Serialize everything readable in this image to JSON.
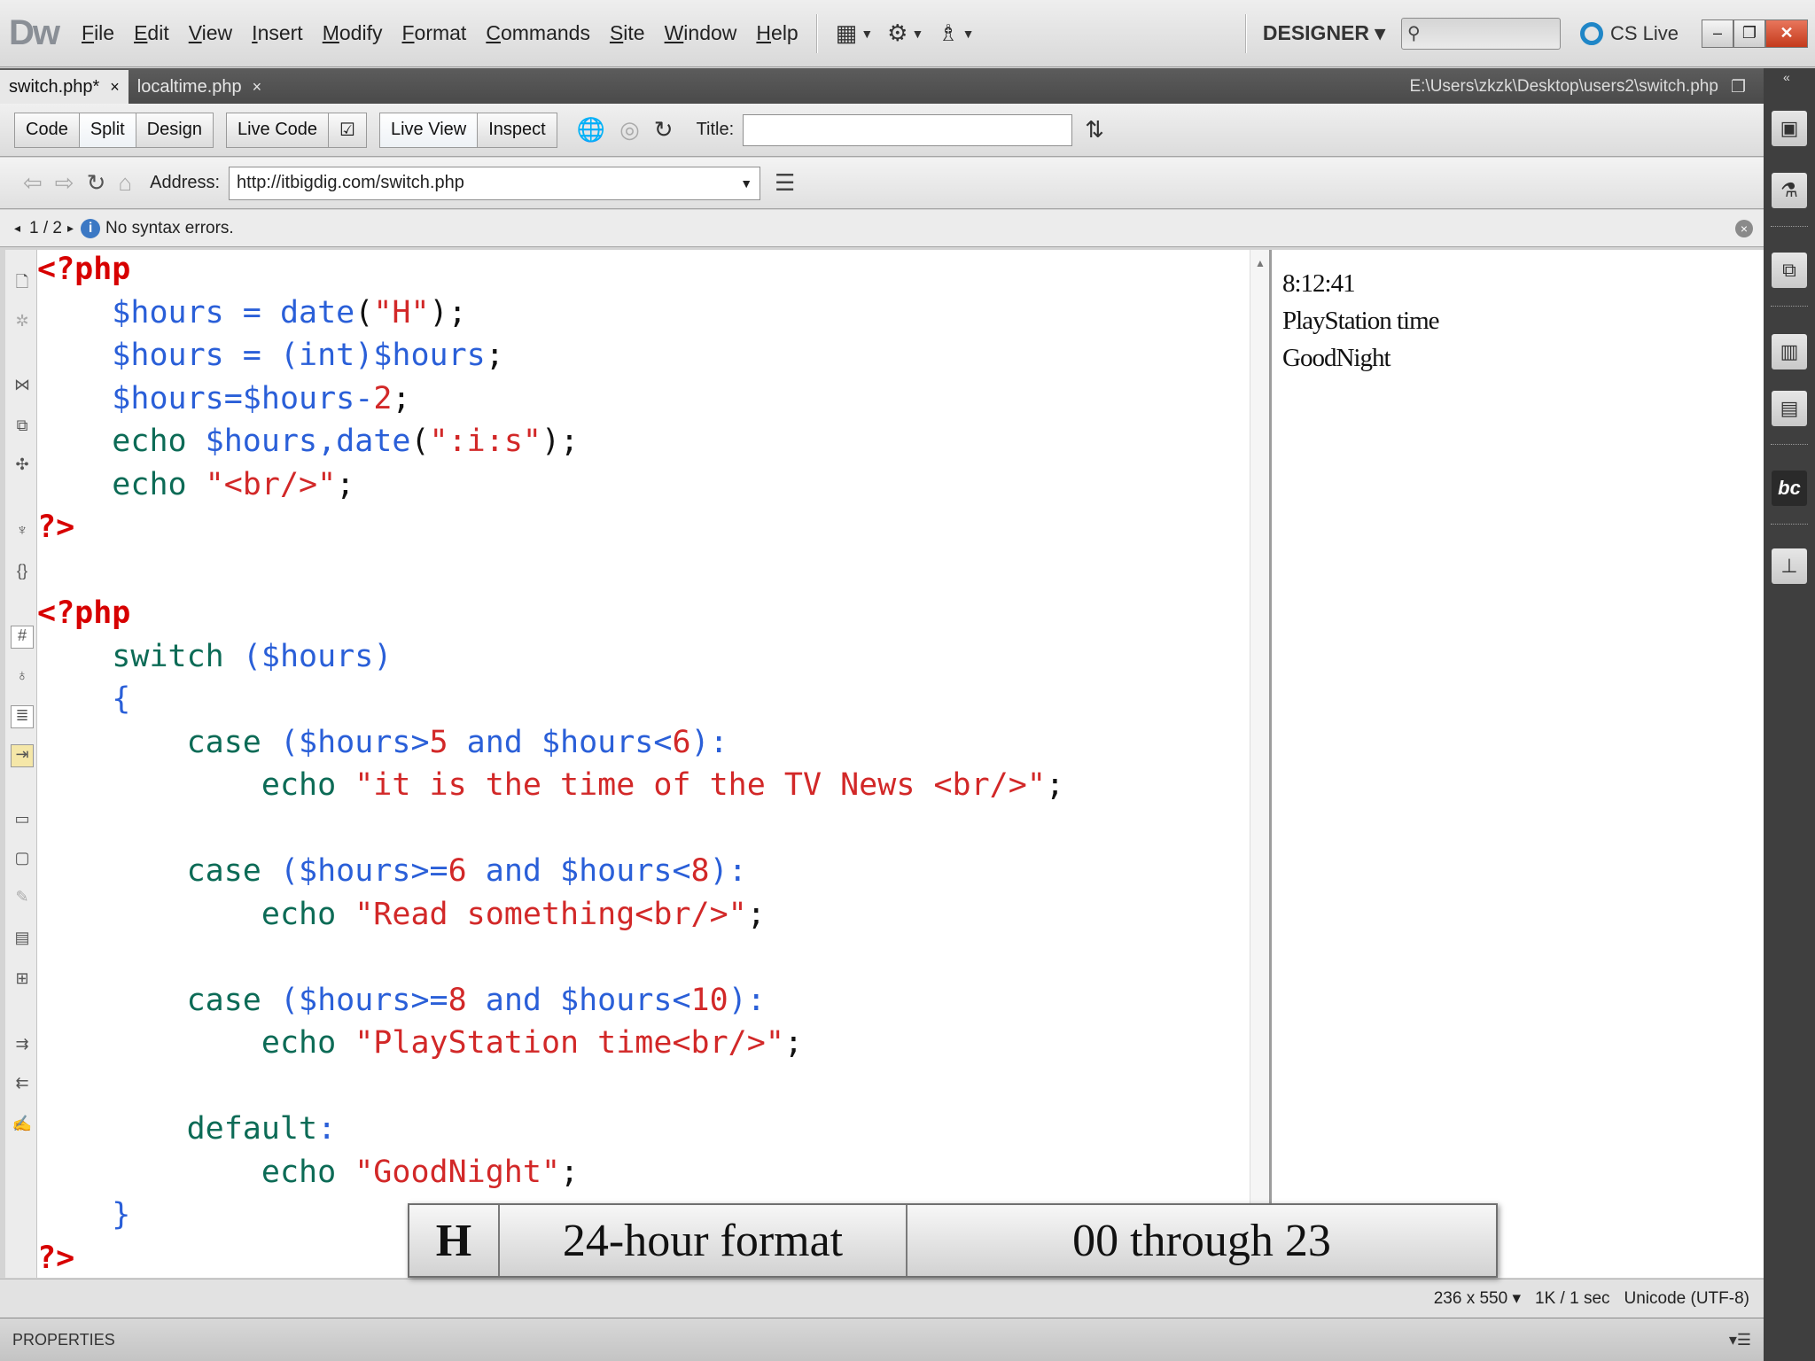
{
  "app": {
    "logo": "Dw",
    "menu": [
      "File",
      "Edit",
      "View",
      "Insert",
      "Modify",
      "Format",
      "Commands",
      "Site",
      "Window",
      "Help"
    ],
    "workspace": "DESIGNER",
    "cslive": "CS Live"
  },
  "tabs": [
    {
      "label": "switch.php*",
      "close": "×"
    },
    {
      "label": "localtime.php",
      "close": "×"
    }
  ],
  "filepath": "E:\\Users\\zkzk\\Desktop\\users2\\switch.php",
  "doc_toolbar": {
    "code": "Code",
    "split": "Split",
    "design": "Design",
    "live_code": "Live Code",
    "live_view": "Live View",
    "inspect": "Inspect",
    "title_label": "Title:",
    "title_value": ""
  },
  "address": {
    "label": "Address:",
    "value": "http://itbigdig.com/switch.php"
  },
  "infobar": {
    "pager": "1 / 2",
    "message": "No syntax errors."
  },
  "code_lines": [
    [
      {
        "c": "tag",
        "t": "<?php"
      }
    ],
    [
      {
        "c": "pn",
        "t": "    "
      },
      {
        "c": "var",
        "t": "$hours"
      },
      {
        "c": "op",
        "t": " = "
      },
      {
        "c": "var",
        "t": "date"
      },
      {
        "c": "pn",
        "t": "("
      },
      {
        "c": "str",
        "t": "\"H\""
      },
      {
        "c": "pn",
        "t": ");"
      }
    ],
    [
      {
        "c": "pn",
        "t": "    "
      },
      {
        "c": "var",
        "t": "$hours"
      },
      {
        "c": "op",
        "t": " = "
      },
      {
        "c": "var",
        "t": "(int)$hours"
      },
      {
        "c": "pn",
        "t": ";"
      }
    ],
    [
      {
        "c": "pn",
        "t": "    "
      },
      {
        "c": "var",
        "t": "$hours=$hours-"
      },
      {
        "c": "num",
        "t": "2"
      },
      {
        "c": "pn",
        "t": ";"
      }
    ],
    [
      {
        "c": "pn",
        "t": "    "
      },
      {
        "c": "kw",
        "t": "echo "
      },
      {
        "c": "var",
        "t": "$hours,date"
      },
      {
        "c": "pn",
        "t": "("
      },
      {
        "c": "str",
        "t": "\":i:s\""
      },
      {
        "c": "pn",
        "t": ");"
      }
    ],
    [
      {
        "c": "pn",
        "t": "    "
      },
      {
        "c": "kw",
        "t": "echo "
      },
      {
        "c": "str",
        "t": "\"<br/>\""
      },
      {
        "c": "pn",
        "t": ";"
      }
    ],
    [
      {
        "c": "tag",
        "t": "?>"
      }
    ],
    [],
    [
      {
        "c": "tag",
        "t": "<?php"
      }
    ],
    [
      {
        "c": "pn",
        "t": "    "
      },
      {
        "c": "kw",
        "t": "switch "
      },
      {
        "c": "var",
        "t": "($hours)"
      }
    ],
    [
      {
        "c": "pn",
        "t": "    "
      },
      {
        "c": "var",
        "t": "{"
      }
    ],
    [
      {
        "c": "pn",
        "t": "        "
      },
      {
        "c": "kw",
        "t": "case "
      },
      {
        "c": "var",
        "t": "($hours>"
      },
      {
        "c": "num",
        "t": "5"
      },
      {
        "c": "var",
        "t": " and $hours<"
      },
      {
        "c": "num",
        "t": "6"
      },
      {
        "c": "var",
        "t": "):"
      }
    ],
    [
      {
        "c": "pn",
        "t": "            "
      },
      {
        "c": "kw",
        "t": "echo "
      },
      {
        "c": "str",
        "t": "\"it is the time of the TV News <br/>\""
      },
      {
        "c": "pn",
        "t": ";"
      }
    ],
    [],
    [
      {
        "c": "pn",
        "t": "        "
      },
      {
        "c": "kw",
        "t": "case "
      },
      {
        "c": "var",
        "t": "($hours>="
      },
      {
        "c": "num",
        "t": "6"
      },
      {
        "c": "var",
        "t": " and $hours<"
      },
      {
        "c": "num",
        "t": "8"
      },
      {
        "c": "var",
        "t": "):"
      }
    ],
    [
      {
        "c": "pn",
        "t": "            "
      },
      {
        "c": "kw",
        "t": "echo "
      },
      {
        "c": "str",
        "t": "\"Read something<br/>\""
      },
      {
        "c": "pn",
        "t": ";"
      }
    ],
    [],
    [
      {
        "c": "pn",
        "t": "        "
      },
      {
        "c": "kw",
        "t": "case "
      },
      {
        "c": "var",
        "t": "($hours>="
      },
      {
        "c": "num",
        "t": "8"
      },
      {
        "c": "var",
        "t": " and $hours<"
      },
      {
        "c": "num",
        "t": "10"
      },
      {
        "c": "var",
        "t": "):"
      }
    ],
    [
      {
        "c": "pn",
        "t": "            "
      },
      {
        "c": "kw",
        "t": "echo "
      },
      {
        "c": "str",
        "t": "\"PlayStation time<br/>\""
      },
      {
        "c": "pn",
        "t": ";"
      }
    ],
    [],
    [
      {
        "c": "pn",
        "t": "        "
      },
      {
        "c": "kw",
        "t": "default"
      },
      {
        "c": "var",
        "t": ":"
      }
    ],
    [
      {
        "c": "pn",
        "t": "            "
      },
      {
        "c": "kw",
        "t": "echo "
      },
      {
        "c": "str",
        "t": "\"GoodNight\""
      },
      {
        "c": "pn",
        "t": ";"
      }
    ],
    [
      {
        "c": "pn",
        "t": "    "
      },
      {
        "c": "var",
        "t": "}"
      }
    ],
    [
      {
        "c": "tag",
        "t": "?>"
      }
    ]
  ],
  "live_view": [
    "8:12:41",
    "PlayStation time",
    "GoodNight"
  ],
  "status": {
    "size": "236 x 550",
    "download": "1K / 1 sec",
    "encoding": "Unicode (UTF-8)"
  },
  "properties": {
    "label": "PROPERTIES"
  },
  "caption": {
    "key": "H",
    "description": "24-hour format",
    "range": "00 through 23"
  },
  "colors": {
    "keyword": "#0c6b56",
    "variable": "#2a5fd8",
    "string": "#d22828",
    "php_tag": "#d70000"
  }
}
